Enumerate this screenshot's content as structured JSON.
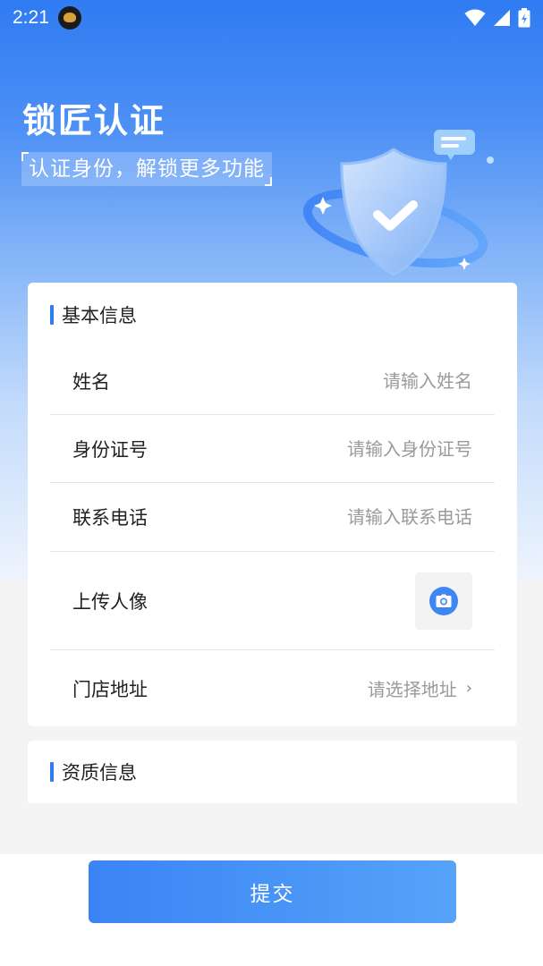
{
  "status_bar": {
    "time": "2:21",
    "app_icon": "lion-app-icon",
    "wifi_icon": "wifi-icon",
    "signal_icon": "cellular-signal-icon",
    "battery_icon": "battery-charging-icon"
  },
  "hero": {
    "title": "锁匠认证",
    "subtitle": "认证身份，解锁更多功能",
    "illustration": "shield-check-icon"
  },
  "basic_info": {
    "section_title": "基本信息",
    "name": {
      "label": "姓名",
      "placeholder": "请输入姓名",
      "value": ""
    },
    "id_number": {
      "label": "身份证号",
      "placeholder": "请输入身份证号",
      "value": ""
    },
    "phone": {
      "label": "联系电话",
      "placeholder": "请输入联系电话",
      "value": ""
    },
    "portrait": {
      "label": "上传人像",
      "icon": "camera-icon"
    },
    "address": {
      "label": "门店地址",
      "placeholder": "请选择地址",
      "icon": "chevron-right-icon"
    }
  },
  "qualification": {
    "section_title": "资质信息"
  },
  "submit_label": "提交",
  "colors": {
    "accent": "#2f7bf2",
    "button_start": "#3a84f5",
    "button_end": "#56a3f8",
    "placeholder": "#9a9a9a"
  }
}
